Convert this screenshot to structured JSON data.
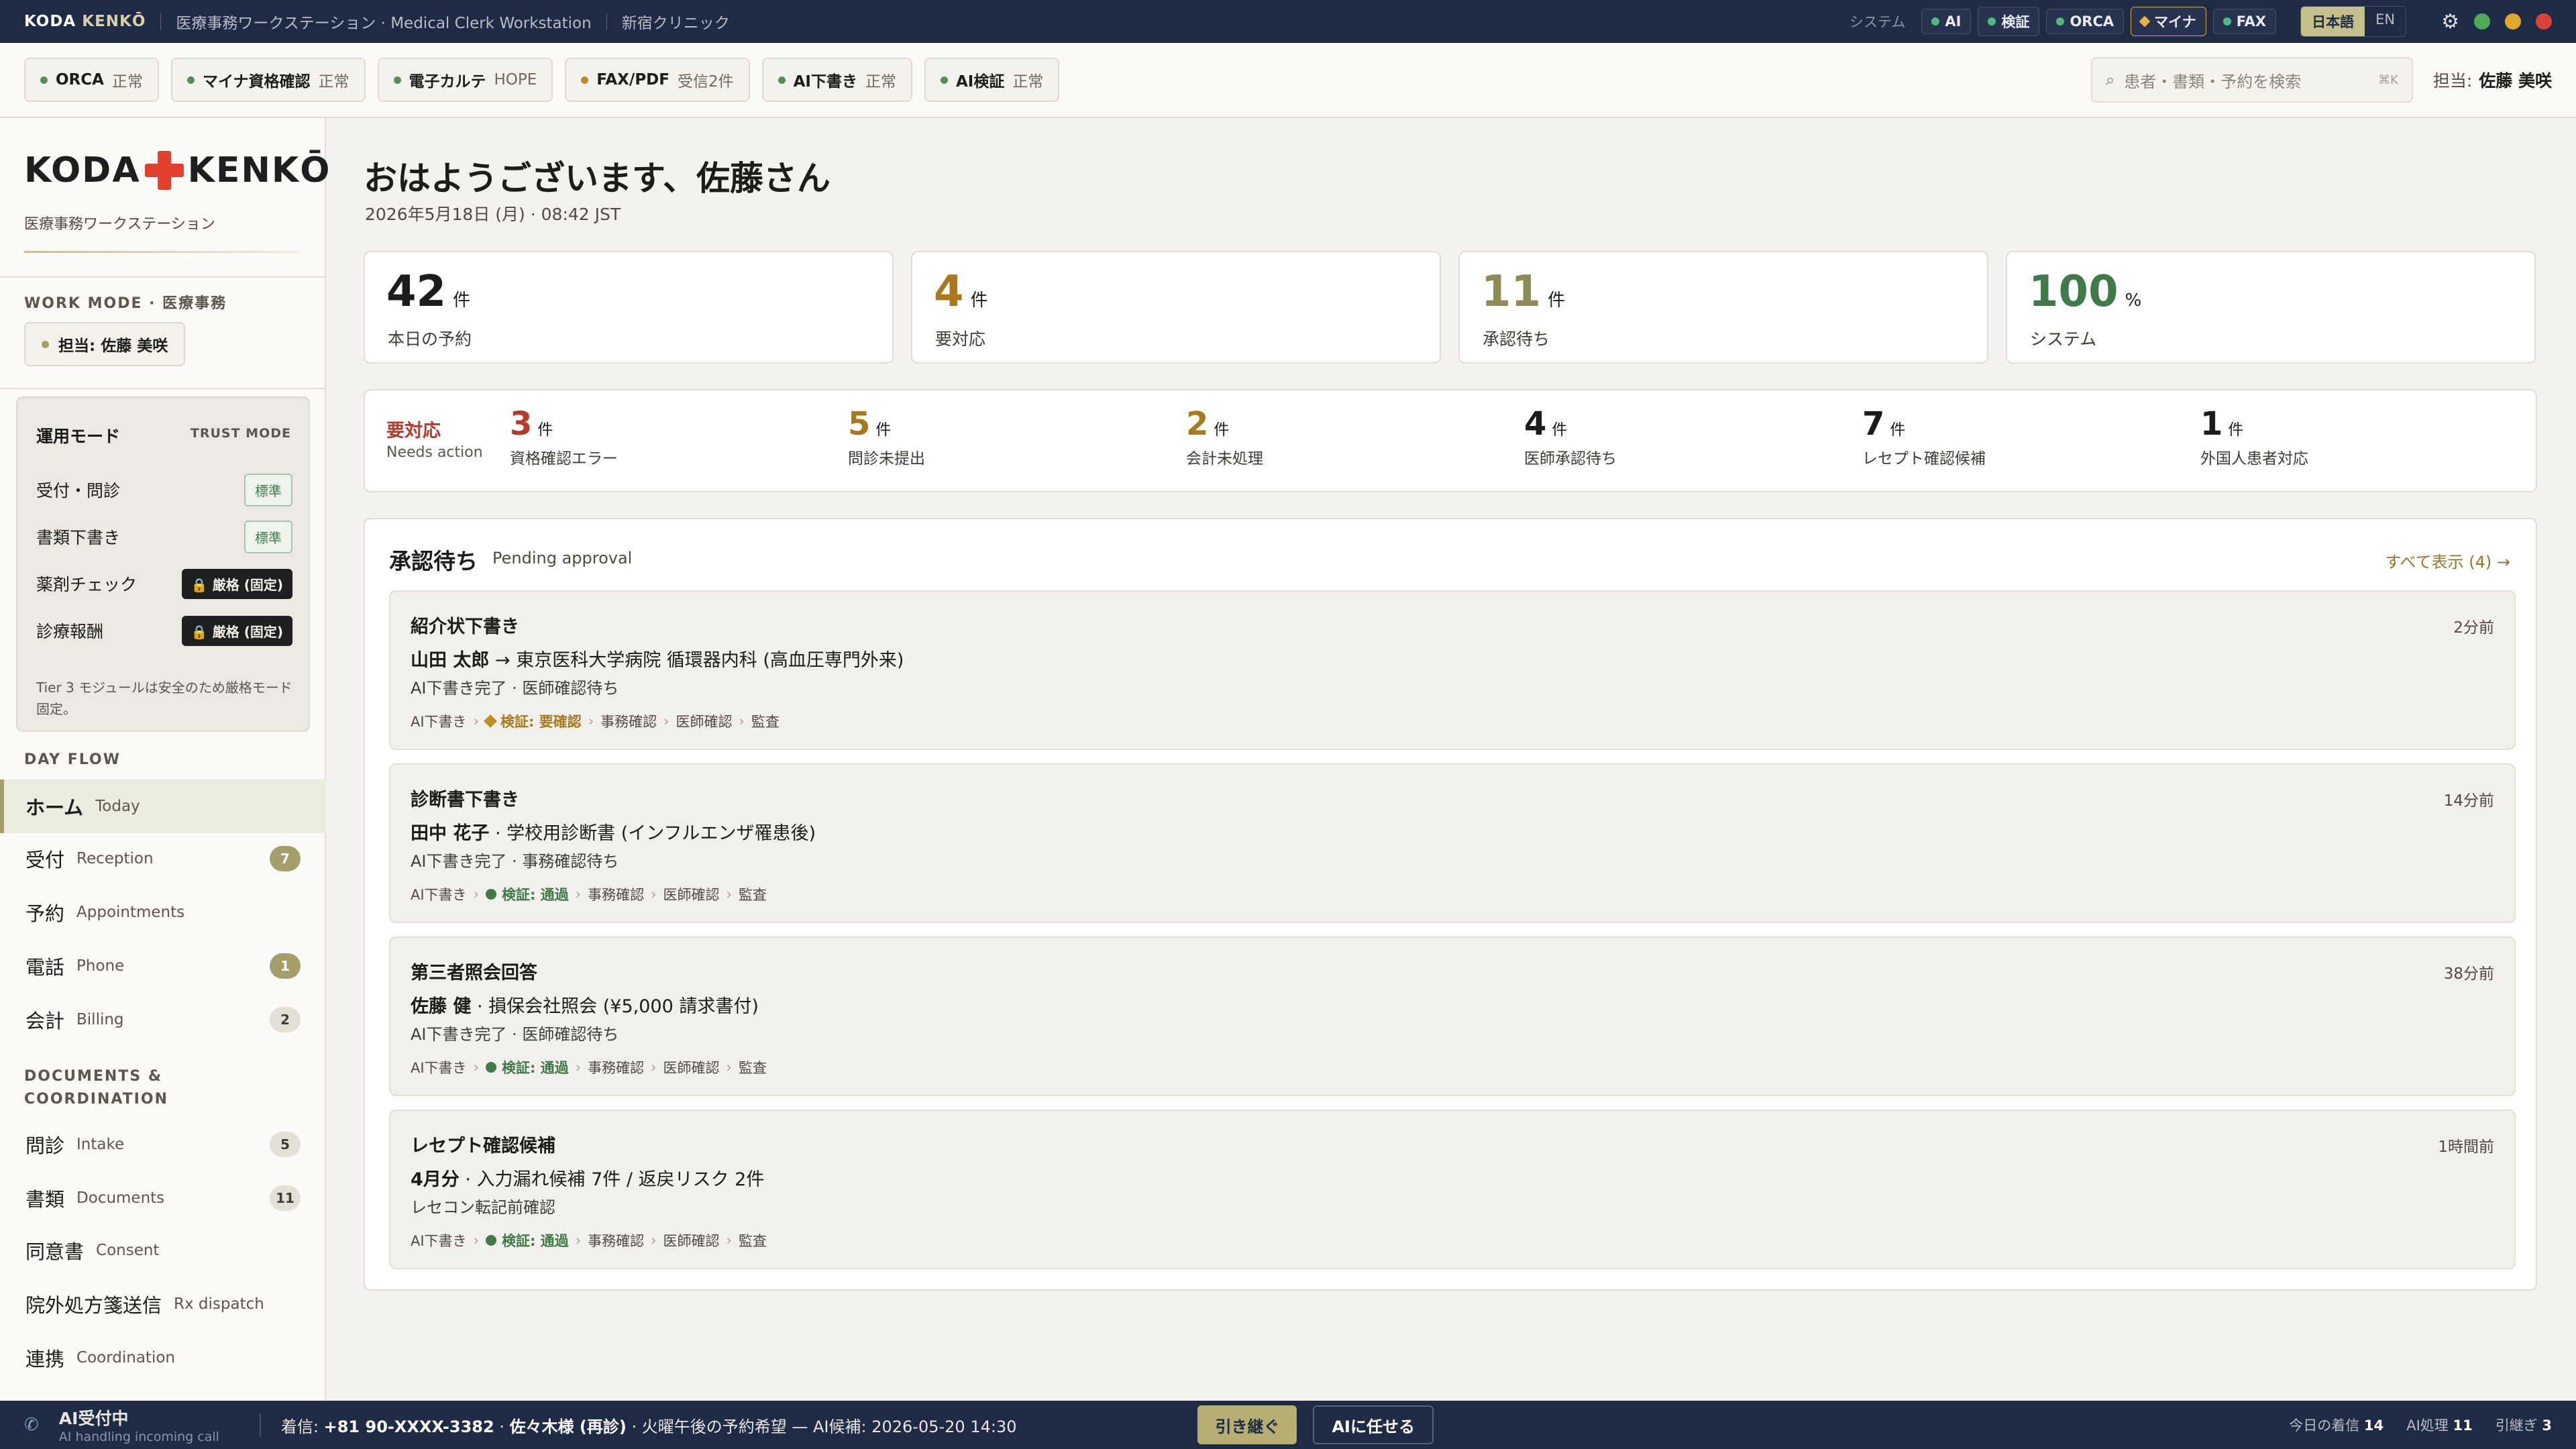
{
  "topbar": {
    "brand_a": "KODA",
    "brand_b": "KENKŌ",
    "subtitle": "医療事務ワークステーション · Medical Clerk Workstation",
    "clinic": "新宿クリニック",
    "system_label": "システム",
    "pills": [
      "AI",
      "検証",
      "ORCA",
      "マイナ",
      "FAX"
    ],
    "lang_ja": "日本語",
    "lang_en": "EN"
  },
  "status_badges": [
    {
      "name": "ORCA",
      "state": "正常"
    },
    {
      "name": "マイナ資格確認",
      "state": "正常"
    },
    {
      "name": "電子カルテ",
      "state": "HOPE"
    },
    {
      "name": "FAX/PDF",
      "state": "受信2件"
    },
    {
      "name": "AI下書き",
      "state": "正常"
    },
    {
      "name": "AI検証",
      "state": "正常"
    }
  ],
  "search": {
    "placeholder": "患者・書類・予約を検索",
    "shortcut": "⌘K"
  },
  "owner": {
    "label": "担当:",
    "name": "佐藤 美咲"
  },
  "sidebar": {
    "logo_a": "KODA",
    "logo_b": "KENKŌ",
    "logo_sub": "医療事務ワークステーション",
    "work_mode": "WORK MODE · 医療事務",
    "owner_chip": "担当: 佐藤 美咲",
    "trust": {
      "title": "運用モード",
      "tag": "TRUST MODE",
      "rows": [
        {
          "label": "受付・問診",
          "mode": "標準"
        },
        {
          "label": "書類下書き",
          "mode": "標準"
        },
        {
          "label": "薬剤チェック",
          "mode": "🔒 厳格 (固定)"
        },
        {
          "label": "診療報酬",
          "mode": "🔒 厳格 (固定)"
        }
      ],
      "note": "Tier 3 モジュールは安全のため厳格モード固定。"
    },
    "day_flow_title": "DAY FLOW",
    "day_flow": [
      {
        "ja": "ホーム",
        "en": "Today",
        "count": ""
      },
      {
        "ja": "受付",
        "en": "Reception",
        "count": "7"
      },
      {
        "ja": "予約",
        "en": "Appointments",
        "count": ""
      },
      {
        "ja": "電話",
        "en": "Phone",
        "count": "1"
      },
      {
        "ja": "会計",
        "en": "Billing",
        "count": "2"
      }
    ],
    "docs_title_1": "DOCUMENTS &",
    "docs_title_2": "COORDINATION",
    "docs": [
      {
        "ja": "問診",
        "en": "Intake",
        "count": "5"
      },
      {
        "ja": "書類",
        "en": "Documents",
        "count": "11"
      },
      {
        "ja": "同意書",
        "en": "Consent",
        "count": ""
      },
      {
        "ja": "院外処方箋送信",
        "en": "Rx dispatch",
        "count": ""
      },
      {
        "ja": "連携",
        "en": "Coordination",
        "count": ""
      }
    ]
  },
  "main": {
    "greeting": "おはようございます、佐藤さん",
    "date": "2026年5月18日 (月) · 08:42 JST",
    "kpis": [
      {
        "value": "42",
        "unit": "件",
        "label": "本日の予約",
        "color": "#1c1c1a"
      },
      {
        "value": "4",
        "unit": "件",
        "label": "要対応",
        "color": "#a9791c"
      },
      {
        "value": "11",
        "unit": "件",
        "label": "承認待ち",
        "color": "#8f8a55"
      },
      {
        "value": "100",
        "unit": "%",
        "label": "システム",
        "color": "#3f7a48"
      }
    ],
    "action": {
      "title": "要対応",
      "subtitle": "Needs action",
      "items": [
        {
          "value": "3",
          "unit": "件",
          "label": "資格確認エラー",
          "color": "#b53a2a"
        },
        {
          "value": "5",
          "unit": "件",
          "label": "問診未提出",
          "color": "#a9791c"
        },
        {
          "value": "2",
          "unit": "件",
          "label": "会計未処理",
          "color": "#a9791c"
        },
        {
          "value": "4",
          "unit": "件",
          "label": "医師承認待ち",
          "color": "#1c1c1a"
        },
        {
          "value": "7",
          "unit": "件",
          "label": "レセプト確認候補",
          "color": "#1c1c1a"
        },
        {
          "value": "1",
          "unit": "件",
          "label": "外国人患者対応",
          "color": "#1c1c1a"
        }
      ]
    },
    "approval": {
      "title": "承認待ち",
      "subtitle": "Pending approval",
      "view_all": "すべて表示 (4) →",
      "cards": [
        {
          "title": "紹介状下書き",
          "time": "2分前",
          "main_bold": "山田 太郎",
          "main_rest": " → 東京医科大学病院 循環器内科 (高血圧専門外来)",
          "sub": "AI下書き完了 · 医師確認待ち",
          "check": "検証: 要確認",
          "check_state": "warn"
        },
        {
          "title": "診断書下書き",
          "time": "14分前",
          "main_bold": "田中 花子",
          "main_rest": " · 学校用診断書 (インフルエンザ罹患後)",
          "sub": "AI下書き完了 · 事務確認待ち",
          "check": "検証: 通過",
          "check_state": "pass"
        },
        {
          "title": "第三者照会回答",
          "time": "38分前",
          "main_bold": "佐藤 健",
          "main_rest": " · 損保会社照会 (¥5,000 請求書付)",
          "sub": "AI下書き完了 · 医師確認待ち",
          "check": "検証: 通過",
          "check_state": "pass"
        },
        {
          "title": "レセプト確認候補",
          "time": "1時間前",
          "main_bold": "4月分",
          "main_rest": " · 入力漏れ候補 7件 / 返戻リスク 2件",
          "sub": "レセコン転記前確認",
          "check": "検証: 通過",
          "check_state": "pass"
        }
      ],
      "steps": {
        "draft": "AI下書き",
        "clerk": "事務確認",
        "doctor": "医師確認",
        "audit": "監査"
      }
    }
  },
  "bottom": {
    "title": "AI受付中",
    "sub": "AI handling incoming call",
    "call_pre": "着信: ",
    "call_num": "+81 90-XXXX-3382",
    "call_sep": " · ",
    "call_name": "佐々木様 (再診)",
    "call_rest": " · 火曜午後の予約希望 — AI候補: 2026-05-20 14:30",
    "btn_take": "引き継ぐ",
    "btn_ai": "AIに任せる",
    "stat1_l": "今日の着信",
    "stat1_v": "14",
    "stat2_l": "AI処理",
    "stat2_v": "11",
    "stat3_l": "引継ぎ",
    "stat3_v": "3"
  },
  "colors": {
    "navy": "#1d2b45",
    "accent": "#a59e6b",
    "danger": "#b53a2a",
    "warn": "#a9791c",
    "ok": "#3f7a48"
  }
}
